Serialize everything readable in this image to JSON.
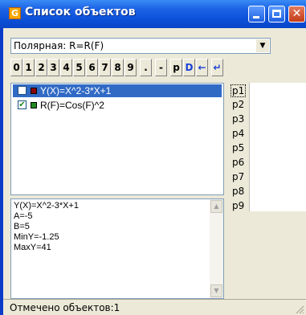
{
  "window": {
    "title": "Список объектов",
    "app_icon": "G"
  },
  "mode_select": {
    "value": "Полярная: R=R(F)"
  },
  "keypad": {
    "buttons": [
      "0",
      "1",
      "2",
      "3",
      "4",
      "5",
      "6",
      "7",
      "8",
      "9",
      ".",
      "-",
      "p",
      "D",
      "←",
      "↵"
    ]
  },
  "objects": [
    {
      "label": "Y(X)=X^2-3*X+1",
      "checked": false,
      "selected": true,
      "color": "#8b0000"
    },
    {
      "label": "R(F)=Cos(F)^2",
      "checked": true,
      "selected": false,
      "color": "#228b22"
    }
  ],
  "params": [
    "p1",
    "p2",
    "p3",
    "p4",
    "p5",
    "p6",
    "p7",
    "p8",
    "p9"
  ],
  "info": {
    "lines": [
      "Y(X)=X^2-3*X+1",
      "A=-5",
      "B=5",
      "MinY=-1.25",
      "MaxY=41"
    ]
  },
  "status": {
    "text": "Отмечено объектов:1"
  },
  "colors": {
    "title_bar": "#0b50d8",
    "selection": "#316ac5",
    "face": "#ece9d8"
  }
}
